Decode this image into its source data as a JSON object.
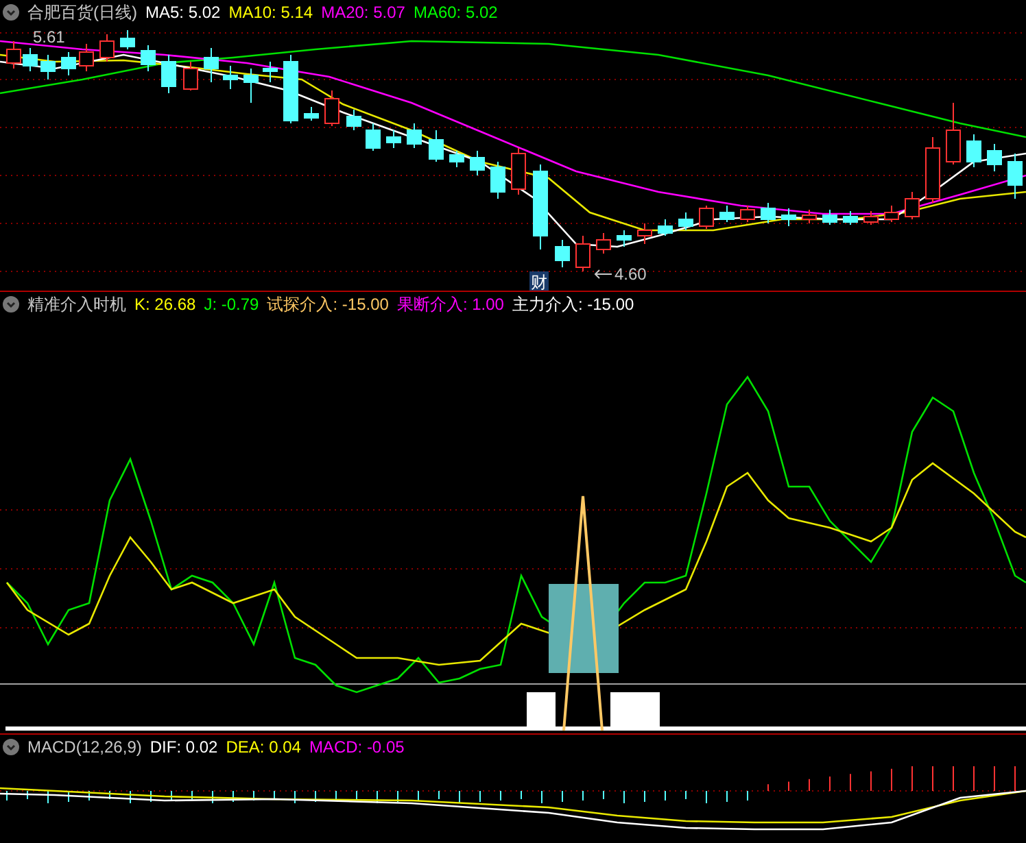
{
  "panels": [
    {
      "title": "合肥百货(日线)",
      "indicators": [
        {
          "label": "MA5: 5.02",
          "color": "#ffffff"
        },
        {
          "label": "MA10: 5.14",
          "color": "#ffff00"
        },
        {
          "label": "MA20: 5.07",
          "color": "#ff00ff"
        },
        {
          "label": "MA60: 5.02",
          "color": "#00ff00"
        }
      ],
      "high_label": "5.61",
      "low_label": "4.60",
      "event_marker": "财"
    },
    {
      "title": "精准介入时机",
      "indicators": [
        {
          "label": "K: 26.68",
          "color": "#ffff00"
        },
        {
          "label": "J: -0.79",
          "color": "#00ff00"
        },
        {
          "label": "试探介入: -15.00",
          "color": "#ffc864"
        },
        {
          "label": "果断介入: 1.00",
          "color": "#ff00ff"
        },
        {
          "label": "主力介入: -15.00",
          "color": "#ffffff"
        }
      ]
    },
    {
      "title": "MACD(12,26,9)",
      "indicators": [
        {
          "label": "DIF: 0.02",
          "color": "#ffffff"
        },
        {
          "label": "DEA: 0.04",
          "color": "#ffff00"
        },
        {
          "label": "MACD: -0.05",
          "color": "#ff00ff"
        }
      ]
    }
  ]
}
